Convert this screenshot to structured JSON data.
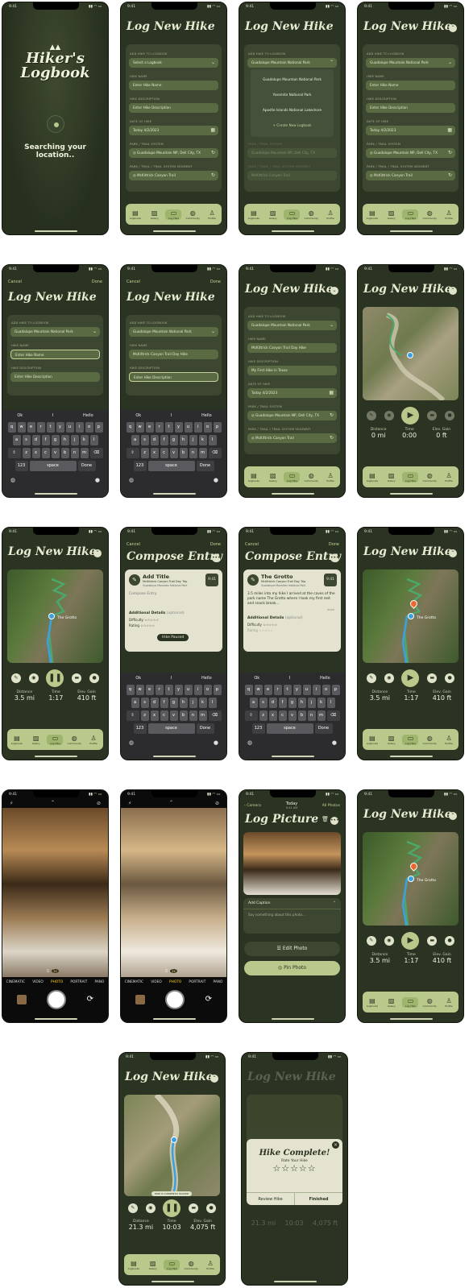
{
  "status": {
    "time": "9:41"
  },
  "splash": {
    "logo_line1": "Hiker's",
    "logo_line2": "Logbook",
    "searching": "Searching your location.."
  },
  "form": {
    "title": "Log New Hike",
    "lbl_logbook": "ADD HIKE TO LOGBOOK",
    "lbl_name": "HIKE NAME",
    "lbl_desc": "HIKE DESCRIPTION",
    "lbl_date": "DATE OF HIKE",
    "lbl_park": "PARK / TRAIL SYSTEM",
    "lbl_trail": "PARK / TRAIL / TRAIL SYSTEM SEGMENT",
    "select_placeholder": "Select a Logbook",
    "logbook_value": "Guadalupe Mountain National Park",
    "name_placeholder": "Enter Hike Name",
    "desc_placeholder": "Enter Hike Description",
    "date_value": "Today 4/2/2023",
    "park_value": "Guadalupe Mountain NP, Dell City, TX",
    "trail_value": "McKittrick Canyon Trail",
    "name_value": "McKittrick Canyon Trail Day Hike",
    "desc_value": "My First Hike in Texas",
    "dropdown": [
      "Guadalupe Mountain National Park",
      "Yosemite National Park",
      "Apostle Islands National Lakeshore"
    ],
    "create_logbook": "+ Create New Logbook",
    "cancel": "Cancel",
    "done": "Done"
  },
  "tabs": [
    {
      "label": "Logbooks",
      "icon": "book-icon"
    },
    {
      "label": "Galery",
      "icon": "image-icon"
    },
    {
      "label": "Log Hike",
      "icon": "hike-icon"
    },
    {
      "label": "Community",
      "icon": "globe-icon"
    },
    {
      "label": "Profile",
      "icon": "person-icon"
    }
  ],
  "keyboard": {
    "suggest": [
      "Ok",
      "I",
      "Hello"
    ],
    "row1": [
      "q",
      "w",
      "e",
      "r",
      "t",
      "y",
      "u",
      "i",
      "o",
      "p"
    ],
    "row2": [
      "a",
      "s",
      "d",
      "f",
      "g",
      "h",
      "j",
      "k",
      "l"
    ],
    "row3": [
      "z",
      "x",
      "c",
      "v",
      "b",
      "n",
      "m"
    ],
    "num": "123",
    "space": "space",
    "done": "Done"
  },
  "stat_labels": {
    "distance": "Distance",
    "time": "Time",
    "elev": "Elev. Gain"
  },
  "tracking0": {
    "distance": "0 mi",
    "time": "0:00",
    "elev": "0 ft"
  },
  "tracking1": {
    "distance": "3.5 mi",
    "time": "1:17",
    "elev": "410 ft"
  },
  "tracking2": {
    "distance": "21.3 mi",
    "time": "10:03",
    "elev": "4,075 ft"
  },
  "map_label": "The Grotto",
  "compose": {
    "title": "Compose Entry",
    "add_title": "Add Title",
    "subtitle1": "McKittrick Canyon Trail Day Trip",
    "subtitle2": "Guadalupe Mountain National Park",
    "time_badge": "9:41",
    "compose_placeholder": "Compose Entry",
    "additional": "Additional Details",
    "optional": "(optional)",
    "difficulty": "Difficulty",
    "rating": "Rating",
    "paused": "Hike Paused",
    "grotto_title": "The Grotto",
    "grotto_body": "3.5 miles into my hike I arrived at the caves of the park name The Grotto where I took my first rest and snack break...",
    "more": "more"
  },
  "camera": {
    "modes": [
      "CINEMATIC",
      "VIDEO",
      "PHOTO",
      "PORTRAIT",
      "PANO"
    ],
    "zoom1": ".5",
    "zoom2": "1x"
  },
  "picture": {
    "back": "Camera",
    "today": "Today",
    "time": "9:41 AM",
    "all": "All Photos",
    "title": "Log Picture",
    "caption": "Add Caption",
    "caption_placeholder": "Say something about this photo...",
    "edit": "Edit Photo",
    "pin": "Pin Photo"
  },
  "hike_paused_pill": "HIKE IS CURRENTLY PAUSED",
  "complete": {
    "title": "Hike Complete!",
    "rate": "Rate Your Hike",
    "review": "Review Hike",
    "finished": "Finished"
  },
  "colors": {
    "bg": "#2b3322",
    "card": "#3c4630",
    "field": "#5a6a43",
    "tabbar": "#b9c98b",
    "accent": "#e8692f",
    "pin": "#3aa0e0"
  }
}
